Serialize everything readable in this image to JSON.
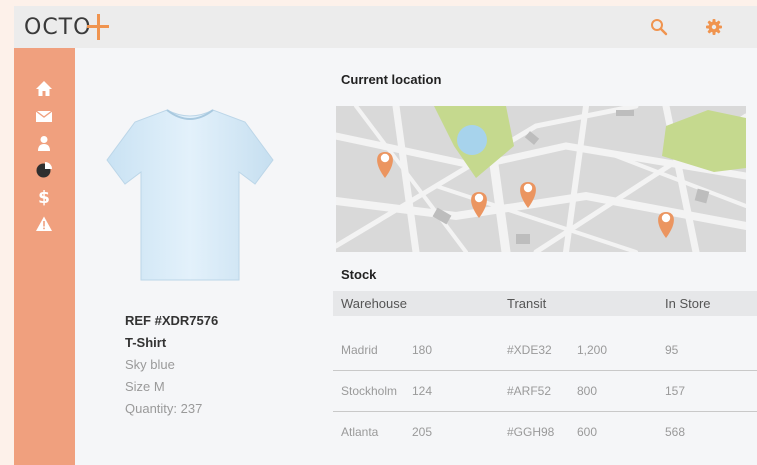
{
  "app": {
    "logo_text": "OCTO",
    "accent_color": "#f0944f",
    "sidebar_color": "#f0a07e"
  },
  "topbar": {
    "icons": [
      "search-icon",
      "gear-icon"
    ]
  },
  "sidebar": {
    "icons": [
      "home-icon",
      "mail-icon",
      "user-icon",
      "pie-chart-icon",
      "dollar-icon",
      "warning-icon"
    ]
  },
  "product": {
    "ref": "REF #XDR7576",
    "name": "T-Shirt",
    "color": "Sky blue",
    "size": "Size M",
    "quantity": "Quantity: 237"
  },
  "location": {
    "title": "Current location"
  },
  "stock": {
    "title": "Stock",
    "headers": {
      "warehouse": "Warehouse",
      "transit": "Transit",
      "in_store": "In Store"
    },
    "rows": [
      {
        "city": "Madrid",
        "warehouse_qty": "180",
        "transit_ref": "#XDE32",
        "transit_qty": "1,200",
        "store_qty": "95"
      },
      {
        "city": "Stockholm",
        "warehouse_qty": "124",
        "transit_ref": "#ARF52",
        "transit_qty": "800",
        "store_qty": "157"
      },
      {
        "city": "Atlanta",
        "warehouse_qty": "205",
        "transit_ref": "#GGH98",
        "transit_qty": "600",
        "store_qty": "568"
      }
    ]
  }
}
